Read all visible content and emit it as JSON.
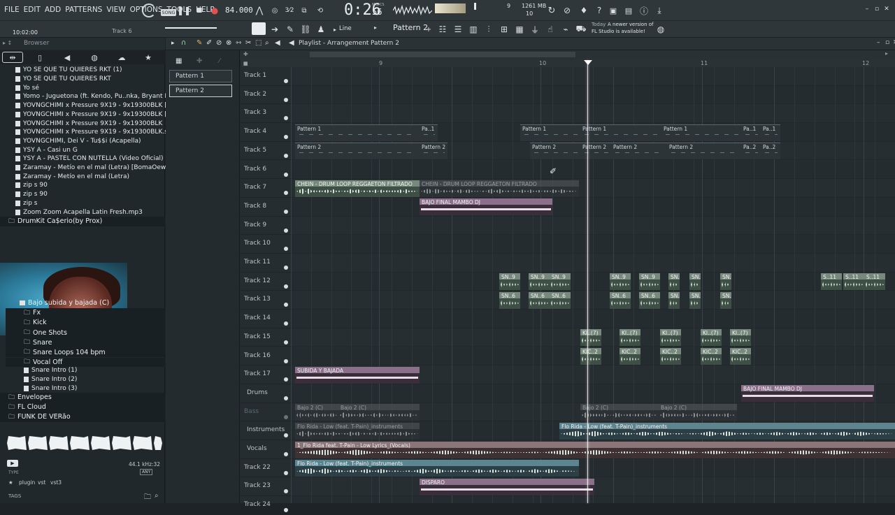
{
  "menu": [
    "FILE",
    "EDIT",
    "ADD",
    "PATTERNS",
    "VIEW",
    "OPTIONS",
    "TOOLS",
    "HELP"
  ],
  "transport": {
    "song_mode": "SONG",
    "tempo": "84.000",
    "time_main": "0:26",
    "time_sub": "56",
    "time_unit": "M:S:CS",
    "cpu_a": "9",
    "mem": "1261 MB",
    "mem_b": "10"
  },
  "hint": {
    "time": "10:02:00",
    "track": "Track 6"
  },
  "toolbar2": {
    "snap": "Line",
    "pattern": "Pattern 2",
    "news_today": "Today",
    "news_text_1": "A newer version of",
    "news_text_2": "FL Studio is available!"
  },
  "browser": {
    "title": "Browser",
    "files": [
      "YO SE QUE TU QUIERES RKT (1)",
      "YO SE QUE TU QUIERES RKT",
      "Yo sé",
      "Yomo - Juguetona (ft. Kendo, Pu..nka, Bryant Myers, Young Izak)",
      "YOVNGCHIMI x Pressure 9X19 - 9x19300BLK [bass]",
      "YOVNGCHIMI x Pressure 9X19 - 9x19300BLK [vocals]",
      "YOVNGCHIMI x Pressure 9X19 - 9x19300BLK",
      "YOVNGCHIMI x Pressure 9X19 - 9x19300BLK.stem",
      "YOVNGCHIMI, Dei V - Tu$$i (Acapella)",
      "YSY A - Casi un G",
      "YSY A - PASTEL CON NUTELLA (Video Oficial)",
      "Zaramay - Metío en el mal (Letra) [BomaOewl4T0]",
      "Zaramay - Metío en el mal (Letra)",
      "zip s 90",
      "zip s 90",
      "zip s",
      "Zoom Zoom Acapella Latin Fresh.mp3"
    ],
    "drumkit": "DrumKit Ca$erio(by Prox)",
    "sub_item": "Bajo subida y bajada (C)",
    "folders": [
      "Fx",
      "Kick",
      "One Shots",
      "Snare",
      "Snare Loops 104 bpm",
      "Vocal Off"
    ],
    "snare_intros": [
      "Snare Intro (1)",
      "Snare Intro (2)",
      "Snare Intro (3)"
    ],
    "bottom_folders": [
      "Envelopes",
      "FL Cloud",
      "FUNK DE VERão"
    ],
    "sample_rate": "44.1 kHz:32",
    "any": "ANY",
    "type_label": "TYPE",
    "tags": [
      "plugin",
      "vst",
      "vst3"
    ],
    "tags_label": "TAGS"
  },
  "picker": {
    "patterns": [
      "Pattern 1",
      "Pattern 2"
    ]
  },
  "playlist": {
    "title": "Playlist - Arrangement",
    "pattern": "Pattern 2",
    "ruler_bars": [
      "9",
      "10",
      "11",
      "12"
    ],
    "tracks": [
      "Track 1",
      "Track 2",
      "Track 3",
      "Track 4",
      "Track 5",
      "Track 6",
      "Track 7",
      "Track 8",
      "Track 9",
      "Track 10",
      "Track 11",
      "Track 12",
      "Track 13",
      "Track 14",
      "Track 15",
      "Track 16",
      "Track 17",
      "Drums",
      "Bass",
      "Instruments",
      "Vocals",
      "Track 22",
      "Track 23",
      "Track 24"
    ],
    "clips": {
      "pattern1": "Pattern 1",
      "pattern2": "Pattern 2",
      "pa1": "Pa..1",
      "pa2": "Pa..2",
      "chein": "CHEIN - DRUM LOOP REGGAETON FILTRADO",
      "bajo_final": "BAJO FINAL MAMBO DJ",
      "sn9": "SN..9",
      "sn6": "SN..6",
      "s11": "S..11",
      "ki7": "KI..(7)",
      "kic2": "KIC..2",
      "subida": "SUBIDA Y BAJADA",
      "bajo2c": "Bajo 2 (C)",
      "flo_inst": "Flo Rida - Low (feat. T-Pain)_instruments",
      "flo_vocals": "1_Flo Rida feat. T-Pain - Low  Lyrics_(Vocals)",
      "disparo": "DISPARO"
    }
  },
  "colors": {
    "green": "#76897c",
    "purple": "#8c6f8a",
    "teal": "#5d8590",
    "rose": "#8a7678",
    "tempo_red": "#e0524e"
  }
}
